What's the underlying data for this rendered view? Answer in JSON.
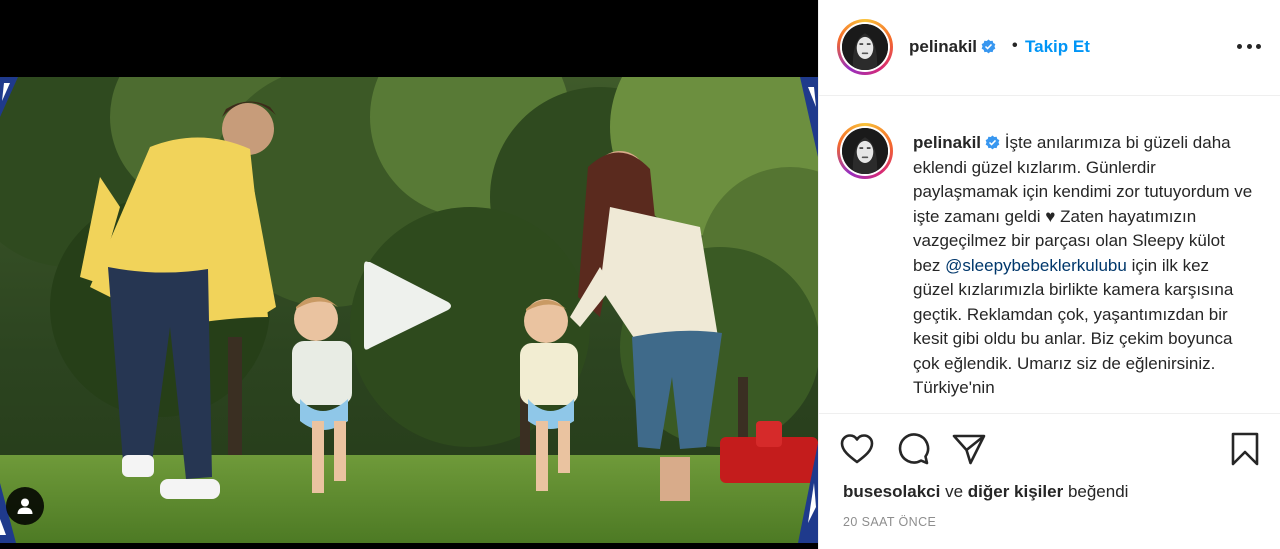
{
  "post": {
    "username": "pelinakil",
    "follow_label": "Takip Et",
    "separator": "•",
    "caption_intro": " İşte anılarımıza bi güzeli daha eklendi güzel kızlarım. Günlerdir paylaşmamak için kendimi zor tutuyordum ve işte zamanı geldi ♥ Zaten hayatımızın vazgeçilmez bir parçası olan Sleepy külot bez ",
    "caption_mention": "@sleepybebeklerkulubu",
    "caption_rest": " için ilk kez güzel kızlarımızla birlikte kamera karşısına geçtik. Reklamdan çok, yaşantımızdan bir kesit gibi oldu bu anlar. Biz çekim boyunca çok eğlendik. Umarız siz de eğlenirsiniz. Türkiye'nin",
    "liked_by_user": "busesolakci",
    "liked_by_connector": "ve",
    "liked_by_others": "diğer kişiler",
    "liked_by_suffix": "beğendi",
    "timestamp": "20 SAAT ÖNCE"
  },
  "icons": {
    "verified": "verified-badge-icon",
    "more": "more-options-icon",
    "like": "heart-icon",
    "comment": "comment-icon",
    "share": "paper-plane-icon",
    "save": "bookmark-icon",
    "play": "play-icon",
    "user_tags": "user-tag-icon"
  },
  "colors": {
    "link_blue": "#0095f6",
    "mention_blue": "#00376b",
    "text": "#262626",
    "muted": "#8e8e8e",
    "media_bg": "#000000"
  }
}
